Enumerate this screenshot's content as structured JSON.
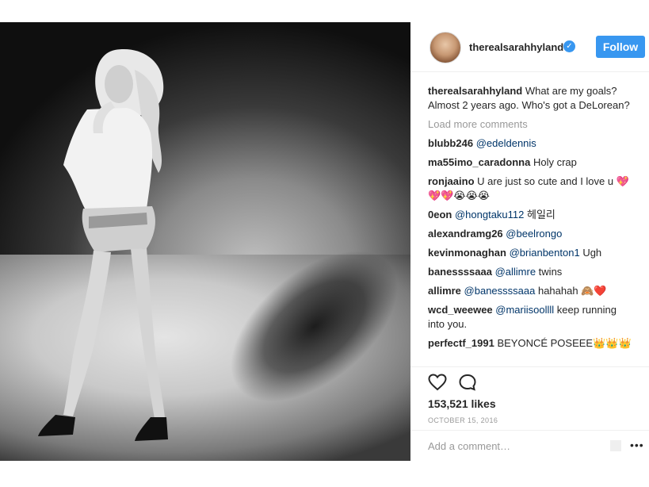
{
  "post": {
    "username": "therealsarahhyland",
    "follow_label": "Follow",
    "caption": {
      "username": "therealsarahhyland",
      "text": " What are my goals? Almost 2 years ago. Who's got a DeLorean?"
    },
    "load_more": "Load more comments",
    "comments": [
      {
        "user": "blubb246",
        "mention": "@edeldennis",
        "text": ""
      },
      {
        "user": "ma55imo_caradonna",
        "mention": "",
        "text": " Holy crap"
      },
      {
        "user": "ronjaaino",
        "mention": "",
        "text": " U are just so cute and I love u 💖💖💖😭😭😭"
      },
      {
        "user": "0eon",
        "mention": "@hongtaku112",
        "text": " 헤일리"
      },
      {
        "user": "alexandramg26",
        "mention": "@beelrongo",
        "text": ""
      },
      {
        "user": "kevinmonaghan",
        "mention": "@brianbenton1",
        "text": " Ugh"
      },
      {
        "user": "banessssaaa",
        "mention": "@allimre",
        "text": " twins"
      },
      {
        "user": "allimre",
        "mention": "@banessssaaa",
        "text": " hahahah 🙈❤️"
      },
      {
        "user": "wcd_weewee",
        "mention": "@mariisoollll",
        "text": " keep running into you."
      },
      {
        "user": "perfectf_1991",
        "mention": "",
        "text": " BEYONCÉ POSEEE👑👑👑"
      }
    ],
    "likes": "153,521 likes",
    "date": "October 15, 2016",
    "add_comment_placeholder": "Add a comment…",
    "options": "•••",
    "verified_mark": "✓",
    "icons": {
      "like": "heart-icon",
      "comment": "comment-icon",
      "verified": "verified-badge-icon"
    }
  }
}
